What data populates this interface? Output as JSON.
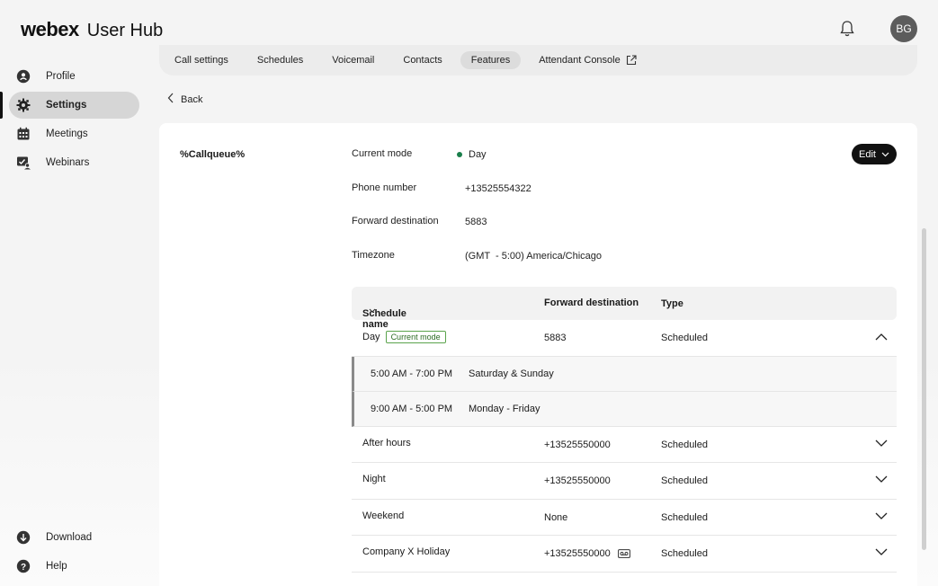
{
  "app": {
    "logo": "webex",
    "title": "User Hub"
  },
  "header": {
    "avatar_initials": "BG",
    "notifications_icon": "bell-icon"
  },
  "sidebar": {
    "items": [
      {
        "label": "Profile",
        "icon": "profile-icon"
      },
      {
        "label": "Settings",
        "icon": "gear-icon",
        "active": true
      },
      {
        "label": "Meetings",
        "icon": "calendar-icon"
      },
      {
        "label": "Webinars",
        "icon": "webinar-icon"
      }
    ],
    "bottom": [
      {
        "label": "Download",
        "icon": "download-icon"
      },
      {
        "label": "Help",
        "icon": "help-icon"
      }
    ]
  },
  "tabs": [
    {
      "label": "Call settings"
    },
    {
      "label": "Schedules"
    },
    {
      "label": "Voicemail"
    },
    {
      "label": "Contacts"
    },
    {
      "label": "Features",
      "active": true
    },
    {
      "label": "Attendant Console",
      "external": true
    }
  ],
  "back_label": "Back",
  "queue": {
    "name": "%Callqueue%",
    "edit_label": "Edit",
    "fields": [
      {
        "label": "Current mode",
        "value": "Day",
        "status_color": "#1a7f4b"
      },
      {
        "label": "Phone number",
        "value": "+13525554322"
      },
      {
        "label": "Forward destination",
        "value": "5883"
      },
      {
        "label": "Timezone",
        "value": "(GMT  - 5:00) America/Chicago"
      }
    ]
  },
  "schedule_table": {
    "headers": {
      "name": "Schedule name",
      "destination": "Forward destination",
      "type": "Type"
    },
    "rows": [
      {
        "name": "Day",
        "badge": "Current mode",
        "destination": "5883",
        "type": "Scheduled",
        "expanded": true,
        "sub": [
          {
            "time": "5:00 AM - 7:00 PM",
            "days": "Saturday & Sunday"
          },
          {
            "time": "9:00 AM - 5:00 PM",
            "days": "Monday - Friday"
          }
        ]
      },
      {
        "name": "After hours",
        "destination": "+13525550000",
        "type": "Scheduled"
      },
      {
        "name": "Night",
        "destination": "+13525550000",
        "type": "Scheduled"
      },
      {
        "name": "Weekend",
        "destination": "None",
        "type": "Scheduled"
      },
      {
        "name": "Company X Holiday",
        "destination": "+13525550000",
        "type": "Scheduled",
        "voicemail_icon": true
      }
    ]
  }
}
